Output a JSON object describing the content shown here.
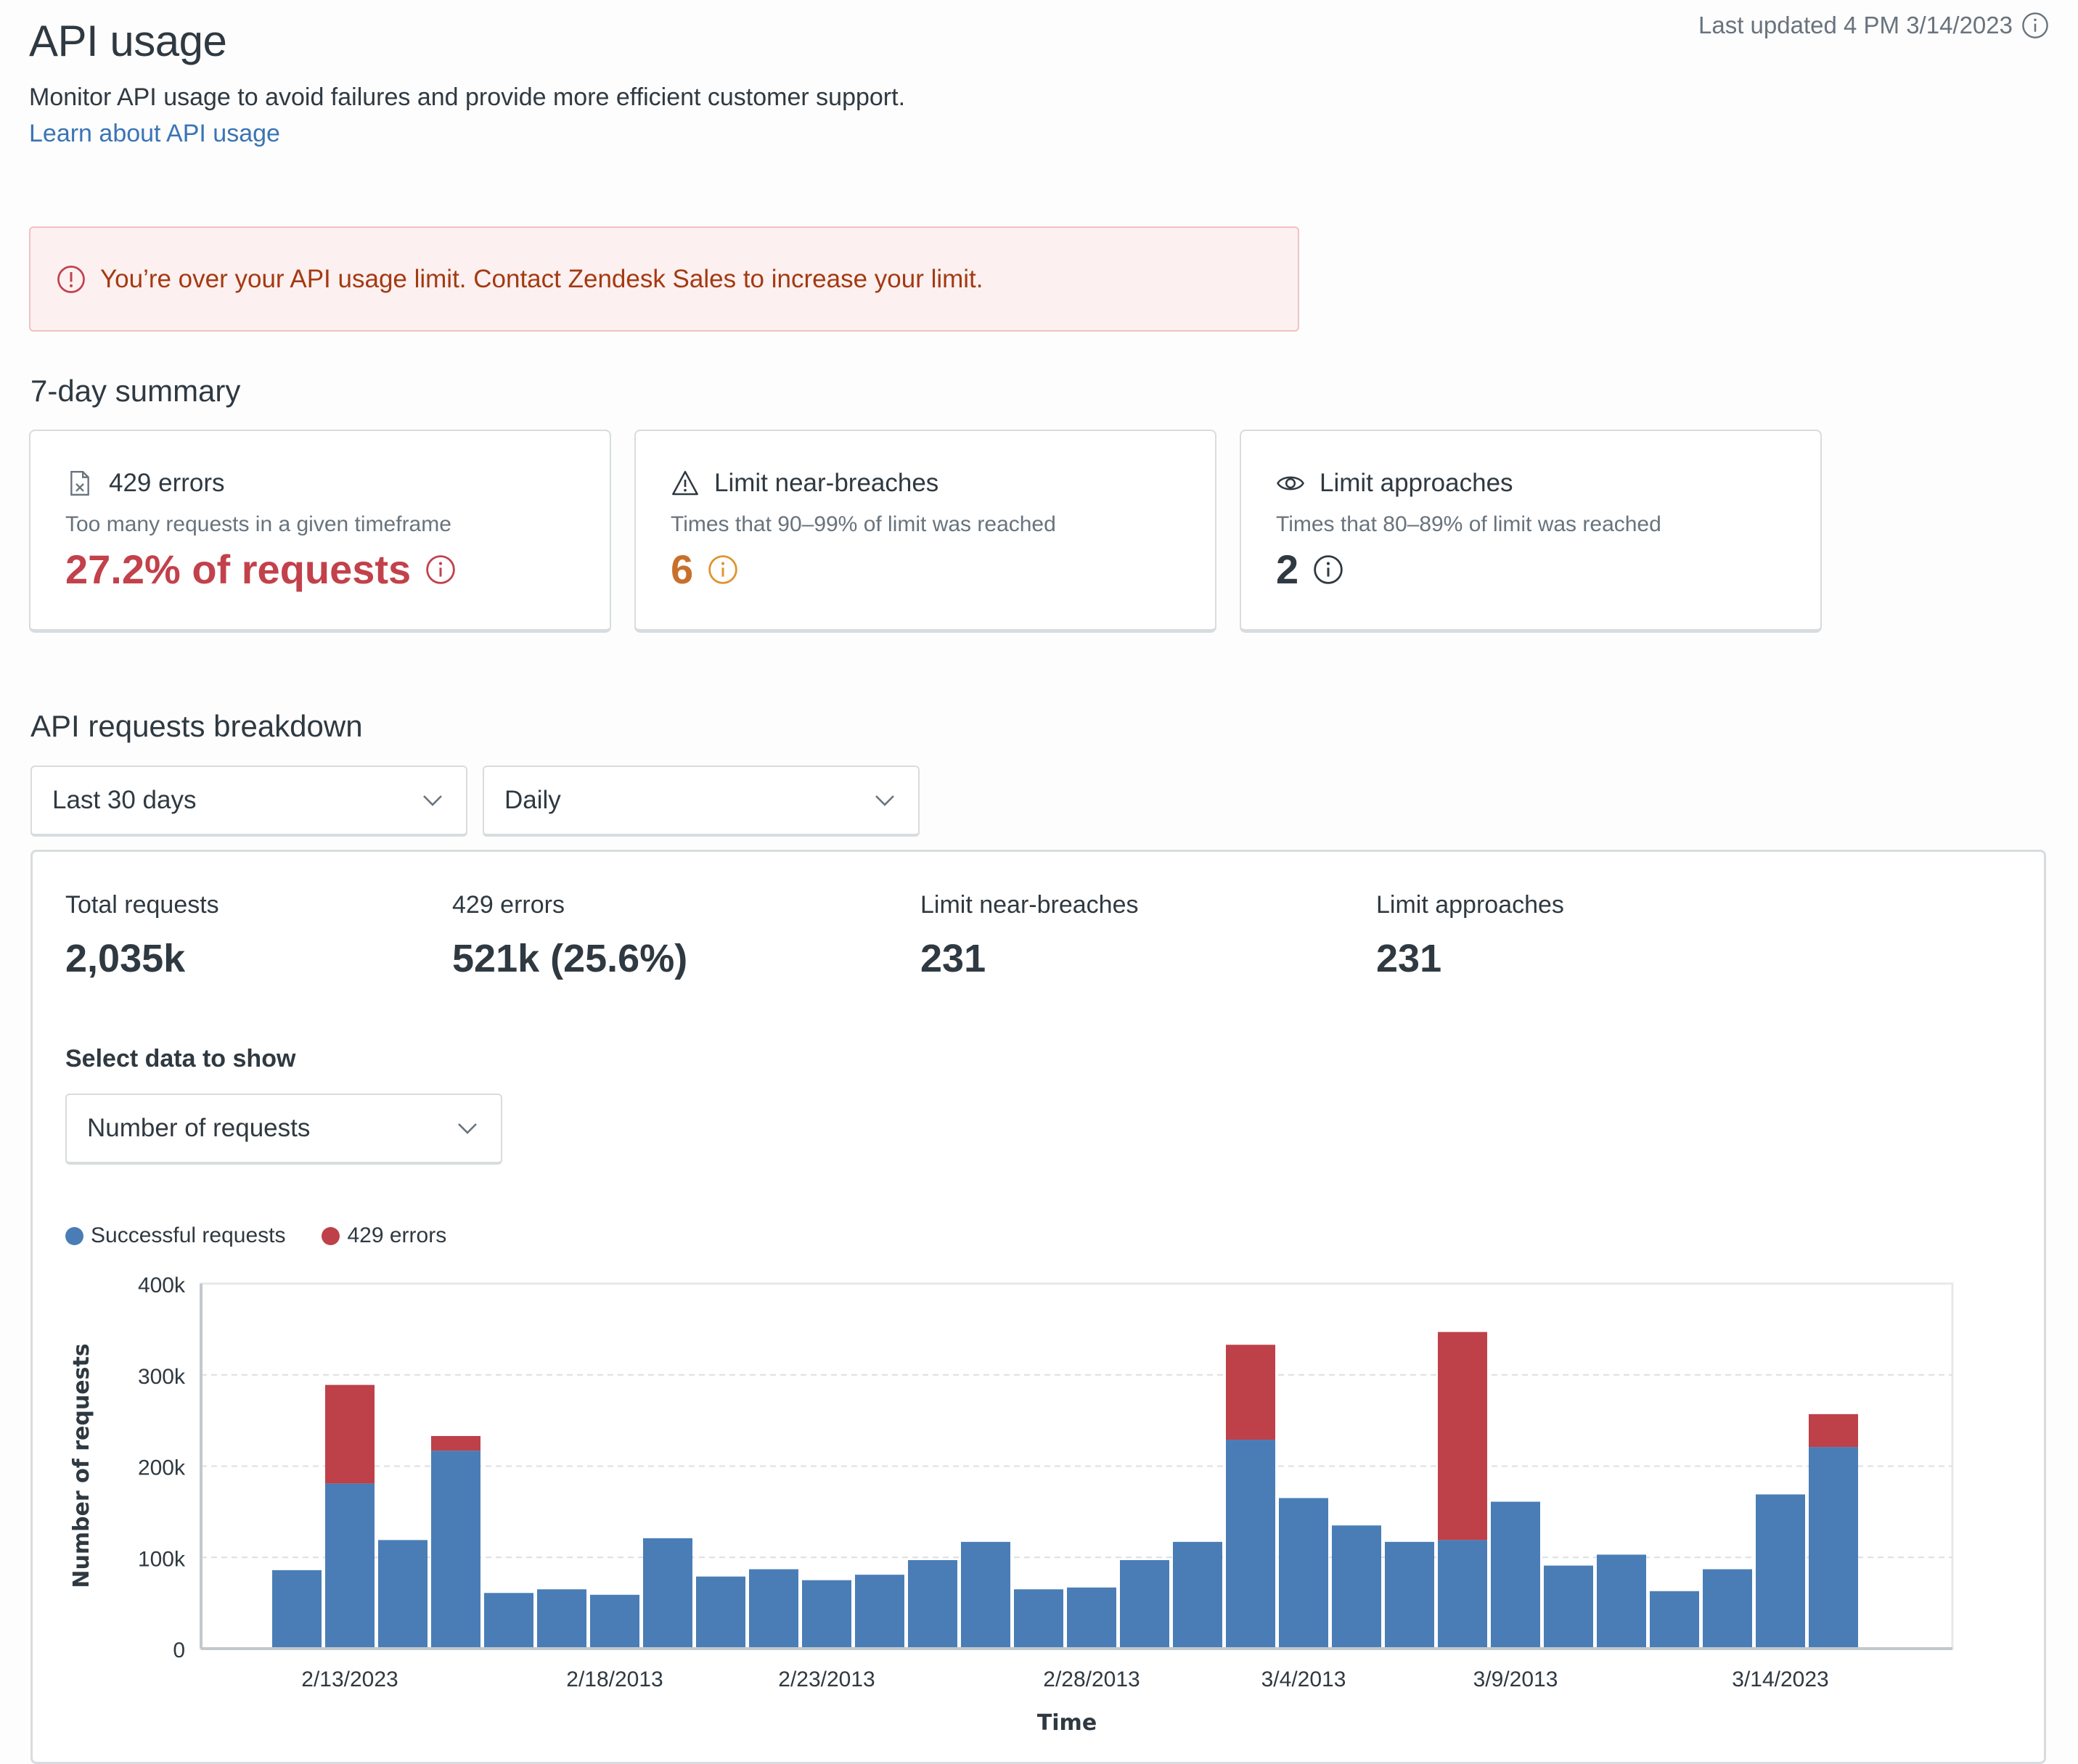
{
  "header": {
    "title": "API usage",
    "subtitle": "Monitor API usage to avoid failures and provide more efficient customer support.",
    "learn_link": "Learn about API usage",
    "last_updated": "Last updated 4 PM 3/14/2023",
    "info_icon": "info-icon"
  },
  "alert": {
    "icon": "alert-circle-icon",
    "message": "You’re over your API usage limit. Contact Zendesk Sales to increase your limit."
  },
  "summary": {
    "title": "7-day summary",
    "cards": [
      {
        "icon": "file-error-icon",
        "title": "429 errors",
        "description": "Too many requests in a given timeframe",
        "value": "27.2% of requests",
        "color": "#c2414b"
      },
      {
        "icon": "warning-triangle-icon",
        "title": "Limit near-breaches",
        "description": "Times that 90–99% of limit was reached",
        "value": "6",
        "color": "#c8702b"
      },
      {
        "icon": "eye-icon",
        "title": "Limit approaches",
        "description": "Times that 80–89% of limit was reached",
        "value": "2",
        "color": "#2f3941"
      }
    ]
  },
  "breakdown": {
    "title": "API requests breakdown",
    "range_select": {
      "value": "Last 30 days"
    },
    "interval_select": {
      "value": "Daily"
    },
    "stats": [
      {
        "label": "Total requests",
        "value": "2,035k"
      },
      {
        "label": "429 errors",
        "value": "521k (25.6%)"
      },
      {
        "label": "Limit near-breaches",
        "value": "231"
      },
      {
        "label": "Limit approaches",
        "value": "231"
      }
    ],
    "data_select": {
      "label": "Select data to show",
      "value": "Number of requests"
    }
  },
  "colors": {
    "success": "#4a7db6",
    "error": "#be4049",
    "alert_bg": "#fcf0f0",
    "link": "#3a74b5"
  },
  "chart_data": {
    "type": "bar",
    "stacked": true,
    "title": "",
    "xlabel": "Time",
    "ylabel": "Number of requests",
    "ylim": [
      0,
      400000
    ],
    "yticks": [
      0,
      100000,
      200000,
      300000,
      400000
    ],
    "ytick_labels": [
      "0",
      "100k",
      "200k",
      "300k",
      "400k"
    ],
    "xtick_labels": [
      {
        "index": 1,
        "label": "2/13/2023"
      },
      {
        "index": 6,
        "label": "2/18/2013"
      },
      {
        "index": 10,
        "label": "2/23/2013"
      },
      {
        "index": 15,
        "label": "2/28/2013"
      },
      {
        "index": 19,
        "label": "3/4/2013"
      },
      {
        "index": 23,
        "label": "3/9/2013"
      },
      {
        "index": 28,
        "label": "3/14/2023"
      }
    ],
    "grid": true,
    "legend": "top-left",
    "series": [
      {
        "name": "Successful requests",
        "color": "#4a7db6",
        "values": [
          86000,
          181000,
          119000,
          217000,
          61000,
          65000,
          59000,
          121000,
          79000,
          87000,
          75000,
          81000,
          97000,
          117000,
          65000,
          67000,
          97000,
          117000,
          229000,
          165000,
          135000,
          117000,
          119000,
          161000,
          91000,
          103000,
          63000,
          87000,
          169000,
          221000
        ]
      },
      {
        "name": "429 errors",
        "color": "#be4049",
        "values": [
          0,
          108000,
          0,
          16000,
          0,
          0,
          0,
          0,
          0,
          0,
          0,
          0,
          0,
          0,
          0,
          0,
          0,
          0,
          104000,
          0,
          0,
          0,
          228000,
          0,
          0,
          0,
          0,
          0,
          0,
          36000
        ]
      }
    ]
  }
}
